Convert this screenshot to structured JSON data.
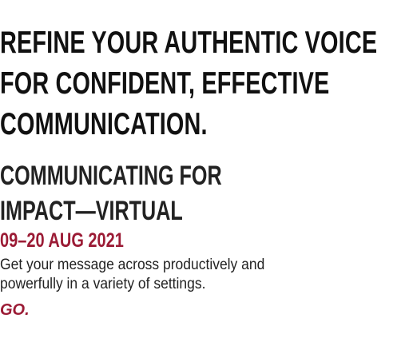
{
  "headline": {
    "lines": [
      "REFINE YOUR AUTHENTIC VOICE",
      "FOR CONFIDENT, EFFECTIVE",
      "COMMUNICATION."
    ]
  },
  "program": {
    "title_lines": [
      "COMMUNICATING FOR",
      "IMPACT—VIRTUAL"
    ],
    "date": "09–20 AUG 2021",
    "description_lines": [
      "Get your message across productively and",
      "powerfully in a variety of settings."
    ],
    "cta_label": "GO."
  },
  "colors": {
    "accent": "#9b1b35",
    "text": "#111111"
  }
}
